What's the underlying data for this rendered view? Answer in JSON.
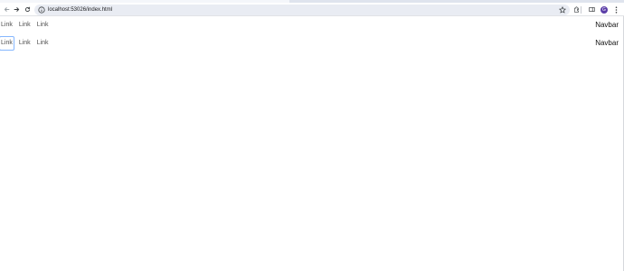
{
  "browser": {
    "url": "localhost:53026/index.html",
    "profile_initial": "G",
    "icons": {
      "back": "arrow-left-icon",
      "forward": "arrow-right-icon",
      "reload": "reload-icon",
      "site_info": "info-icon",
      "bookmark": "star-icon",
      "extensions": "puzzle-icon",
      "sidebar": "sidebar-icon",
      "menu": "kebab-menu-icon"
    }
  },
  "navbars": [
    {
      "links": [
        "Link",
        "Link",
        "Link"
      ],
      "brand": "Navbar"
    },
    {
      "links": [
        "Link",
        "Link",
        "Link"
      ],
      "brand": "Navbar",
      "focused_link": 0
    }
  ],
  "colors": {
    "link": "#505050",
    "focus_ring": "#86b7fe",
    "avatar": "#5b3ea8"
  }
}
